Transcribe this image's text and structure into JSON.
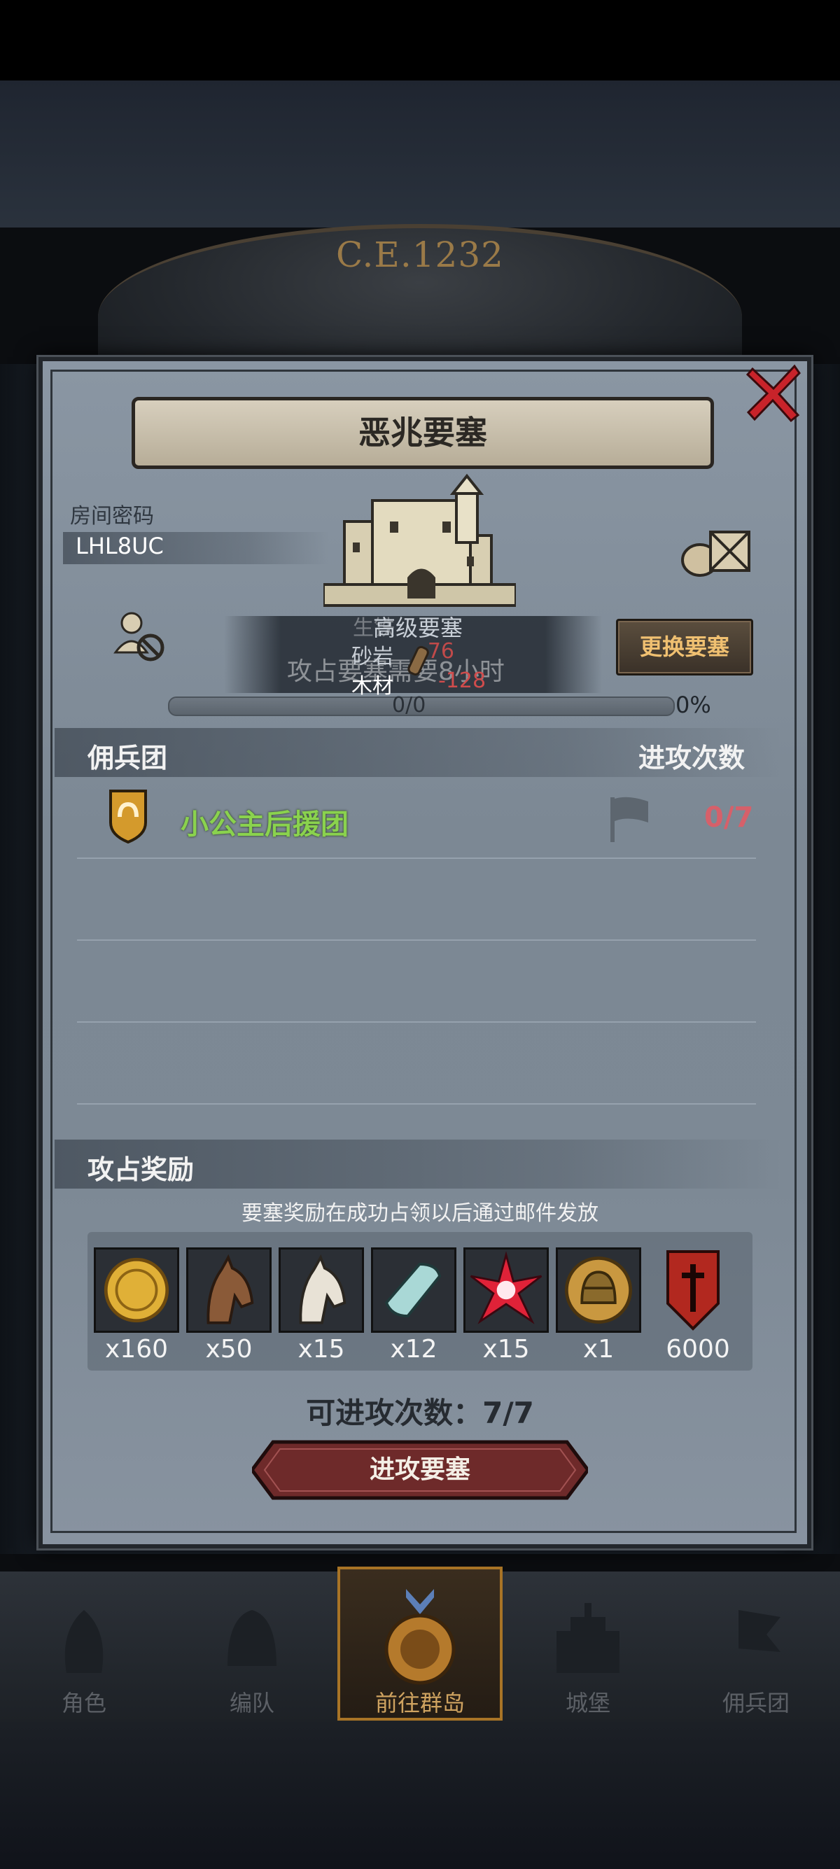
{
  "header": {
    "era": "C.E.1232"
  },
  "dialog": {
    "title": "恶兆要塞",
    "room_label": "房间密码",
    "room_code": "LHL8UC",
    "fortress_level": "高级要塞",
    "capture_text": "攻占要塞需要8小时",
    "resources": [
      {
        "label": "生铁",
        "value": ""
      },
      {
        "label": "砂岩",
        "value": "-76"
      },
      {
        "label": "木材",
        "value": "-128"
      }
    ],
    "change_button": "更换要塞",
    "progress": {
      "count": "0/0",
      "percent": "0%",
      "fraction": 0
    },
    "mercenary_header": "佣兵团",
    "attack_header": "进攻次数",
    "mercenaries": [
      {
        "name": "小公主后援团",
        "count": "0/7"
      }
    ],
    "reward_header": "攻占奖励",
    "reward_note": "要塞奖励在成功占领以后通过邮件发放",
    "rewards": [
      {
        "icon": "gold-coin-icon",
        "qty": "x160"
      },
      {
        "icon": "brown-horse-icon",
        "qty": "x50"
      },
      {
        "icon": "white-horse-icon",
        "qty": "x15"
      },
      {
        "icon": "cloth-roll-icon",
        "qty": "x12"
      },
      {
        "icon": "red-star-icon",
        "qty": "x15"
      },
      {
        "icon": "knight-helmet-coin-icon",
        "qty": "x1"
      },
      {
        "icon": "red-banner-icon",
        "qty": "6000"
      }
    ],
    "attack_count": "可进攻次数：7/7",
    "attack_button": "进攻要塞"
  },
  "nav": {
    "items": [
      {
        "label": "角色"
      },
      {
        "label": "编队"
      },
      {
        "label": "前往群岛"
      },
      {
        "label": "城堡"
      },
      {
        "label": "佣兵团"
      }
    ],
    "active_index": 2
  },
  "colors": {
    "accent_green": "#8ad24e",
    "count_red": "#d6606a",
    "button_gold": "#f0c071"
  }
}
